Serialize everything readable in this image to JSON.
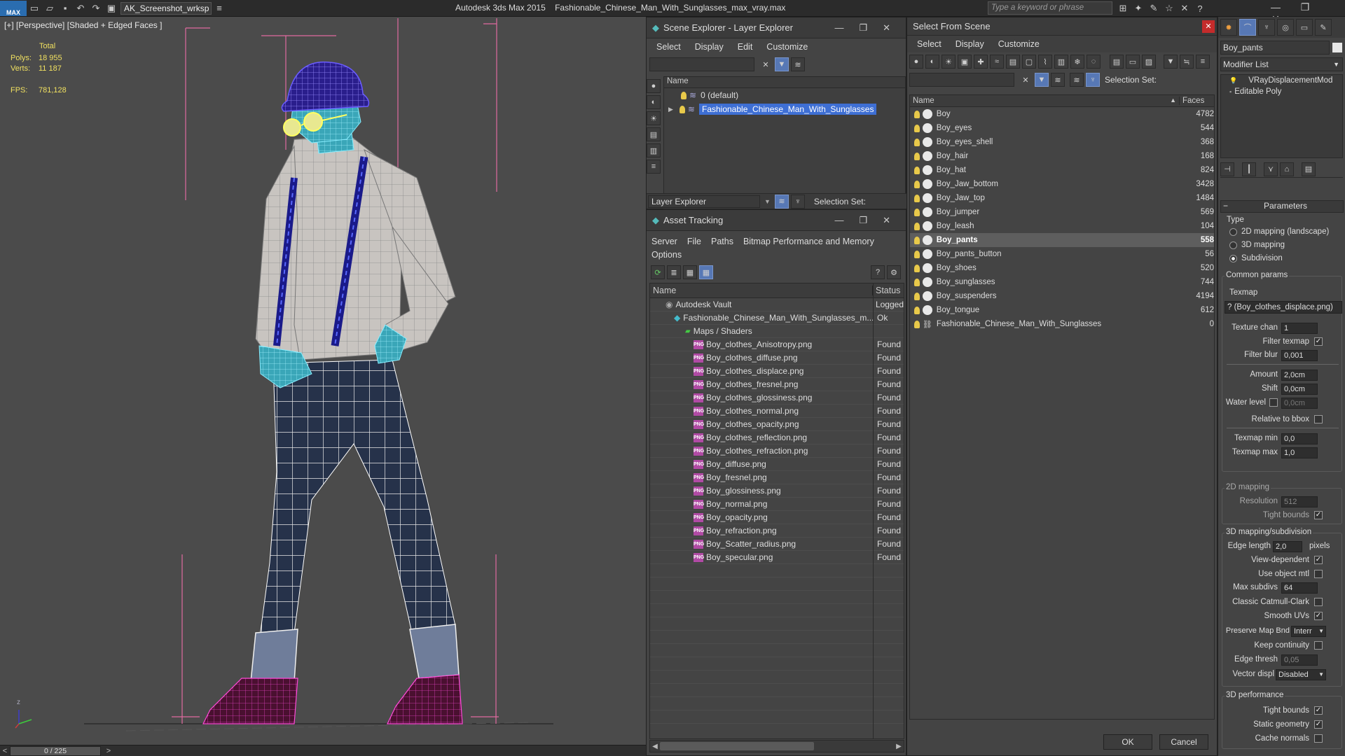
{
  "titlebar": {
    "logo": "MAX",
    "workspace": "AK_Screenshot_wrksp",
    "app_title": "Autodesk 3ds Max  2015",
    "file_title": "Fashionable_Chinese_Man_With_Sunglasses_max_vray.max",
    "search_placeholder": "Type a keyword or phrase"
  },
  "viewport": {
    "label": "[+] [Perspective] [Shaded + Edged Faces ]",
    "stats": {
      "total_label": "Total",
      "polys_label": "Polys:",
      "polys_value": "18 955",
      "verts_label": "Verts:",
      "verts_value": "11 187",
      "fps_label": "FPS:",
      "fps_value": "781,128"
    },
    "axis_label": "z"
  },
  "statusbar": {
    "frame": "0 / 225",
    "prev": "<",
    "next": ">"
  },
  "scene_explorer": {
    "title": "Scene Explorer - Layer Explorer",
    "menu": [
      "Select",
      "Display",
      "Edit",
      "Customize"
    ],
    "col_name": "Name",
    "layers": [
      "0 (default)",
      "Fashionable_Chinese_Man_With_Sunglasses"
    ],
    "footer_dropdown": "Layer Explorer",
    "footer_selection": "Selection Set:"
  },
  "asset_tracking": {
    "title": "Asset Tracking",
    "menu": [
      "Server",
      "File",
      "Paths",
      "Bitmap Performance and Memory"
    ],
    "menu2": "Options",
    "col_name": "Name",
    "col_status": "Status",
    "rows": [
      {
        "name": "Autodesk Vault",
        "status": "Logged"
      },
      {
        "name": "Fashionable_Chinese_Man_With_Sunglasses_m...",
        "status": "Ok"
      },
      {
        "name": "Maps / Shaders",
        "status": ""
      },
      {
        "name": "Boy_clothes_Anisotropy.png",
        "status": "Found"
      },
      {
        "name": "Boy_clothes_diffuse.png",
        "status": "Found"
      },
      {
        "name": "Boy_clothes_displace.png",
        "status": "Found"
      },
      {
        "name": "Boy_clothes_fresnel.png",
        "status": "Found"
      },
      {
        "name": "Boy_clothes_glossiness.png",
        "status": "Found"
      },
      {
        "name": "Boy_clothes_normal.png",
        "status": "Found"
      },
      {
        "name": "Boy_clothes_opacity.png",
        "status": "Found"
      },
      {
        "name": "Boy_clothes_reflection.png",
        "status": "Found"
      },
      {
        "name": "Boy_clothes_refraction.png",
        "status": "Found"
      },
      {
        "name": "Boy_diffuse.png",
        "status": "Found"
      },
      {
        "name": "Boy_fresnel.png",
        "status": "Found"
      },
      {
        "name": "Boy_glossiness.png",
        "status": "Found"
      },
      {
        "name": "Boy_normal.png",
        "status": "Found"
      },
      {
        "name": "Boy_opacity.png",
        "status": "Found"
      },
      {
        "name": "Boy_refraction.png",
        "status": "Found"
      },
      {
        "name": "Boy_Scatter_radius.png",
        "status": "Found"
      },
      {
        "name": "Boy_specular.png",
        "status": "Found"
      }
    ],
    "png_label": "PNG"
  },
  "select_from_scene": {
    "title": "Select From Scene",
    "menu": [
      "Select",
      "Display",
      "Customize"
    ],
    "selection_set": "Selection Set:",
    "col_name": "Name",
    "col_faces": "Faces",
    "rows": [
      {
        "name": "Boy",
        "faces": "4782"
      },
      {
        "name": "Boy_eyes",
        "faces": "544"
      },
      {
        "name": "Boy_eyes_shell",
        "faces": "368"
      },
      {
        "name": "Boy_hair",
        "faces": "168"
      },
      {
        "name": "Boy_hat",
        "faces": "824"
      },
      {
        "name": "Boy_Jaw_bottom",
        "faces": "3428"
      },
      {
        "name": "Boy_Jaw_top",
        "faces": "1484"
      },
      {
        "name": "Boy_jumper",
        "faces": "569"
      },
      {
        "name": "Boy_leash",
        "faces": "104"
      },
      {
        "name": "Boy_pants",
        "faces": "558"
      },
      {
        "name": "Boy_pants_button",
        "faces": "56"
      },
      {
        "name": "Boy_shoes",
        "faces": "520"
      },
      {
        "name": "Boy_sunglasses",
        "faces": "744"
      },
      {
        "name": "Boy_suspenders",
        "faces": "4194"
      },
      {
        "name": "Boy_tongue",
        "faces": "612"
      },
      {
        "name": "Fashionable_Chinese_Man_With_Sunglasses",
        "faces": "0"
      }
    ],
    "ok": "OK",
    "cancel": "Cancel"
  },
  "modify_panel": {
    "object_name": "Boy_pants",
    "modifier_list": "Modifier List",
    "stack": [
      "VRayDisplacementMod",
      "Editable Poly"
    ],
    "rollout": "Parameters",
    "type_group": "Type",
    "type_options": [
      "2D mapping (landscape)",
      "3D mapping",
      "Subdivision"
    ],
    "common_group": "Common params",
    "texmap_label": "Texmap",
    "texmap_value": "? (Boy_clothes_displace.png)",
    "texture_chan_label": "Texture chan",
    "texture_chan_value": "1",
    "filter_texmap_label": "Filter texmap",
    "filter_blur_label": "Filter blur",
    "filter_blur_value": "0,001",
    "amount_label": "Amount",
    "amount_value": "2,0cm",
    "shift_label": "Shift",
    "shift_value": "0,0cm",
    "water_level_label": "Water level",
    "water_level_value": "0,0cm",
    "relative_bbox_label": "Relative to bbox",
    "texmap_min_label": "Texmap min",
    "texmap_min_value": "0,0",
    "texmap_max_label": "Texmap max",
    "texmap_max_value": "1,0",
    "mapping2d_group": "2D mapping",
    "resolution_label": "Resolution",
    "resolution_value": "512",
    "tight_bounds_label": "Tight bounds",
    "mapping3d_group": "3D mapping/subdivision",
    "edge_length_label": "Edge length",
    "edge_length_value": "2,0",
    "pixels_label": "pixels",
    "view_dependent_label": "View-dependent",
    "use_object_mtl_label": "Use object mtl",
    "max_subdivs_label": "Max subdivs",
    "max_subdivs_value": "64",
    "classic_cc_label": "Classic Catmull-Clark",
    "smooth_uvs_label": "Smooth UVs",
    "preserve_map_label": "Preserve Map Bnd",
    "preserve_map_value": "Interr",
    "keep_continuity_label": "Keep continuity",
    "edge_thresh_label": "Edge thresh",
    "edge_thresh_value": "0,05",
    "vector_displ_label": "Vector displ",
    "vector_displ_value": "Disabled",
    "perf_group": "3D performance",
    "tight_bounds2_label": "Tight bounds",
    "static_geometry_label": "Static geometry",
    "cache_normals_label": "Cache normals"
  },
  "colors": {
    "accent_blue": "#3e6fd4",
    "bulb": "#e8c94a",
    "png_icon": "#b04aa4",
    "stats_text": "#f0e060"
  }
}
